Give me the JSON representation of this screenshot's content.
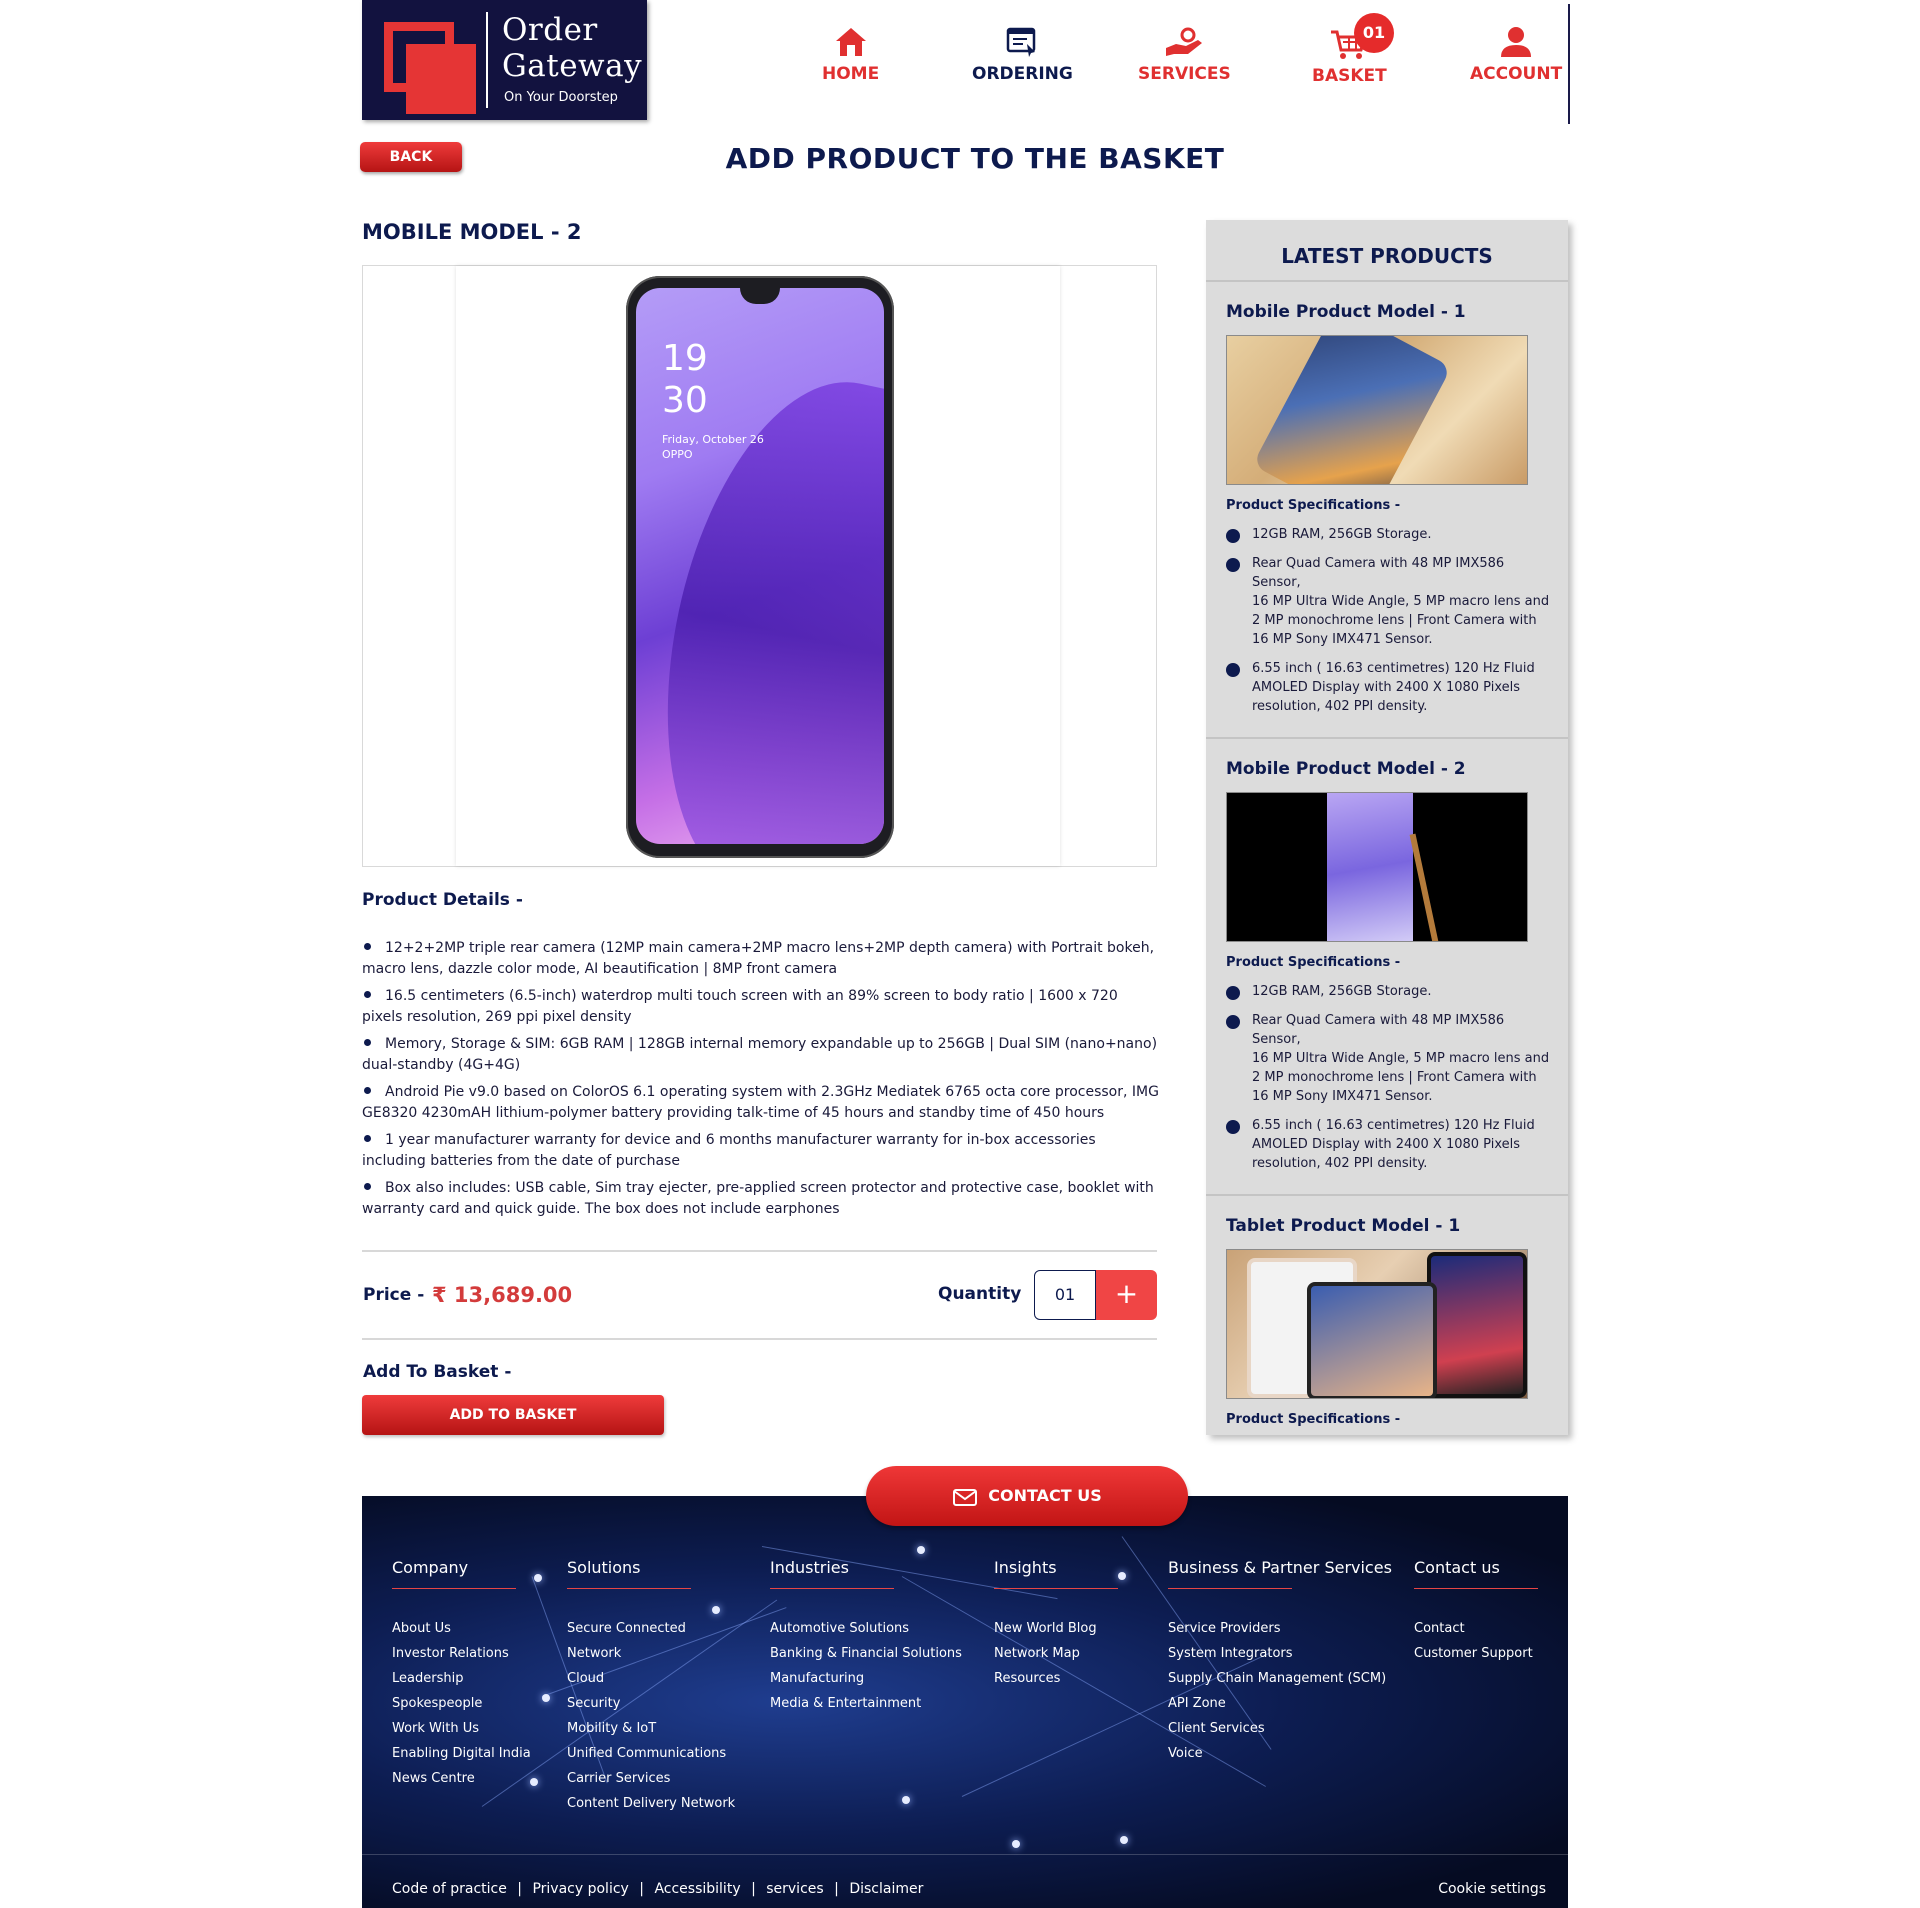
{
  "brand": {
    "line1": "Order",
    "line2": "Gateway",
    "tagline": "On Your Doorstep",
    "accent_color": "#e53535",
    "navy_color": "#12123f"
  },
  "nav": {
    "items": [
      {
        "label": "HOME",
        "icon": "home-icon",
        "color": "#e03030"
      },
      {
        "label": "ORDERING",
        "icon": "ordering-icon",
        "color": "#0d1a4e"
      },
      {
        "label": "SERVICES",
        "icon": "services-icon",
        "color": "#e03030"
      },
      {
        "label": "BASKET",
        "icon": "cart-icon",
        "color": "#e03030"
      },
      {
        "label": "ACCOUNT",
        "icon": "account-icon",
        "color": "#e03030"
      }
    ],
    "basket_count": "01"
  },
  "page": {
    "back_label": "BACK",
    "title": "ADD PRODUCT TO THE BASKET"
  },
  "product": {
    "title": "MOBILE MODEL - 2",
    "screen_time_hours": "19",
    "screen_time_minutes": "30",
    "screen_date": "Friday, October 26",
    "screen_brand": "OPPO",
    "details_title": "Product Details -",
    "details": [
      "12+2+2MP triple rear camera (12MP main camera+2MP macro lens+2MP depth camera) with Portrait bokeh, macro lens, dazzle color mode, AI beautification | 8MP front camera",
      "16.5 centimeters (6.5-inch) waterdrop multi touch screen with an 89% screen to body ratio | 1600 x 720 pixels resolution, 269 ppi pixel density",
      "Memory, Storage & SIM: 6GB RAM | 128GB internal memory expandable up to 256GB | Dual SIM (nano+nano) dual-standby (4G+4G)",
      "Android Pie v9.0 based on ColorOS 6.1 operating system with 2.3GHz Mediatek 6765 octa core processor, IMG GE8320 4230mAH lithium-polymer battery providing talk-time of 45 hours and standby time of 450 hours",
      "1 year manufacturer warranty for device and 6 months manufacturer warranty for in-box accessories including batteries from the date of purchase",
      "Box also includes: USB cable, Sim tray ejecter, pre-applied screen protector and protective case, booklet with warranty card and quick guide. The box does not include earphones"
    ],
    "price_label": "Price -",
    "price_value": "₹ 13,689.00",
    "quantity_label": "Quantity",
    "quantity_value": "01",
    "plus_symbol": "+",
    "add_label": "Add To Basket -",
    "add_button": "ADD TO BASKET"
  },
  "sidebar": {
    "title": "LATEST PRODUCTS",
    "spec_label": "Product Specifications -",
    "products": [
      {
        "name": "Mobile Product Model - 1",
        "specs": [
          "12GB RAM, 256GB Storage.",
          "Rear Quad Camera with 48 MP IMX586 Sensor,\n16 MP Ultra Wide Angle, 5 MP macro lens and 2 MP monochrome lens | Front Camera with 16 MP Sony IMX471 Sensor.",
          "6.55 inch ( 16.63 centimetres) 120 Hz Fluid AMOLED Display with 2400 X 1080 Pixels resolution, 402 PPI density."
        ]
      },
      {
        "name": "Mobile Product Model - 2",
        "specs": [
          "12GB RAM, 256GB Storage.",
          "Rear Quad Camera with 48 MP IMX586 Sensor,\n16 MP Ultra Wide Angle, 5 MP macro lens and 2 MP monochrome lens | Front Camera with 16 MP Sony IMX471 Sensor.",
          "6.55 inch ( 16.63 centimetres) 120 Hz Fluid AMOLED Display with 2400 X 1080 Pixels  resolution, 402 PPI density."
        ]
      },
      {
        "name": "Tablet Product Model - 1",
        "specs": []
      }
    ]
  },
  "footer": {
    "contact_button": "CONTACT US",
    "columns": [
      {
        "heading": "Company",
        "links": [
          "About Us",
          "Investor Relations",
          "Leadership",
          "Spokespeople",
          "Work With Us",
          "Enabling Digital India",
          "News Centre"
        ]
      },
      {
        "heading": "Solutions",
        "links": [
          "Secure Connected",
          "Network",
          "Cloud",
          "Security",
          "Mobility & IoT",
          "Unified Communications",
          "Carrier Services",
          "Content Delivery Network"
        ]
      },
      {
        "heading": "Industries",
        "links": [
          "Automotive Solutions",
          "Banking & Financial Solutions",
          "Manufacturing",
          "Media & Entertainment"
        ]
      },
      {
        "heading": "Insights",
        "links": [
          "New World Blog",
          "Network Map",
          "Resources"
        ]
      },
      {
        "heading": "Business & Partner Services",
        "links": [
          "Service Providers",
          "System Integrators",
          "Supply Chain Management (SCM)",
          "API Zone",
          "Client Services",
          "Voice"
        ]
      },
      {
        "heading": "Contact us",
        "links": [
          "Contact",
          "Customer Support"
        ]
      }
    ],
    "bottom_links": [
      "Code of practice",
      "Privacy policy",
      "Accessibility",
      "services",
      "Disclaimer"
    ],
    "separator": "|",
    "cookie": "Cookie settings"
  }
}
